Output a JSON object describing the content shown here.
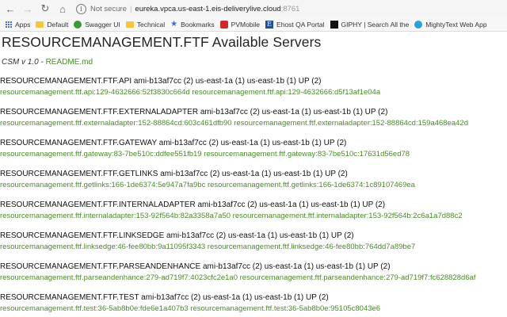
{
  "browser": {
    "security_label": "Not secure",
    "url_host": "eureka.vpca.us-east-1.eis-deliverylive.cloud",
    "url_port": ":8761",
    "bookmarks": [
      {
        "label": "Apps",
        "icon": "apps-grid-icon"
      },
      {
        "label": "Default",
        "icon": "folder-icon"
      },
      {
        "label": "Swagger UI",
        "icon": "swagger-icon"
      },
      {
        "label": "Technical",
        "icon": "folder-icon"
      },
      {
        "label": "Bookmarks",
        "icon": "star-icon"
      },
      {
        "label": "PVMobile",
        "icon": "pvmobile-icon"
      },
      {
        "label": "Ehost QA Portal",
        "icon": "ehost-icon"
      },
      {
        "label": "GIPHY | Search All the",
        "icon": "giphy-icon"
      },
      {
        "label": "MightyText Web App",
        "icon": "mightytext-icon"
      }
    ]
  },
  "page": {
    "title": "RESOURCEMANAGEMENT.FTF Available Servers",
    "version": "CSM v 1.0 - ",
    "readme_link": "README.md"
  },
  "servers": [
    {
      "name": "RESOURCEMANAGEMENT.FTF.API",
      "details": "ami-b13af7cc (2) us-east-1a (1) us-east-1b (1) UP (2)",
      "links": "resourcemanagement.ftf.api:129-4632666:52f3830c664d resourcemanagement.ftf.api:129-4632666:d5f13af1e04a"
    },
    {
      "name": "RESOURCEMANAGEMENT.FTF.EXTERNALADAPTER",
      "details": "ami-b13af7cc (2) us-east-1a (1) us-east-1b (1) UP (2)",
      "links": "resourcemanagement.ftf.externaladapter:152-88864cd:603c461dfb90 resourcemanagement.ftf.externaladapter:152-88864cd:159a468ea42d"
    },
    {
      "name": "RESOURCEMANAGEMENT.FTF.GATEWAY",
      "details": "ami-b13af7cc (2) us-east-1a (1) us-east-1b (1) UP (2)",
      "links": "resourcemanagement.ftf.gateway:83-7be510c:ddfee551fb19 resourcemanagement.ftf.gateway:83-7be510c:17631d56ed78"
    },
    {
      "name": "RESOURCEMANAGEMENT.FTF.GETLINKS",
      "details": "ami-b13af7cc (2) us-east-1a (1) us-east-1b (1) UP (2)",
      "links": "resourcemanagement.ftf.getlinks:166-1de6374:5e947a7fa9bc resourcemanagement.ftf.getlinks:166-1de6374:1c89107469ea"
    },
    {
      "name": "RESOURCEMANAGEMENT.FTF.INTERNALADAPTER",
      "details": "ami-b13af7cc (2) us-east-1a (1) us-east-1b (1) UP (2)",
      "links": "resourcemanagement.ftf.internaladapter:153-92f564b:82a3358a7a50 resourcemanagement.ftf.internaladapter:153-92f564b:2c6a1a7d88c2"
    },
    {
      "name": "RESOURCEMANAGEMENT.FTF.LINKSEDGE",
      "details": "ami-b13af7cc (2) us-east-1a (1) us-east-1b (1) UP (2)",
      "links": "resourcemanagement.ftf.linksedge:46-fee80bb:9a11095f3343 resourcemanagement.ftf.linksedge:46-fee80bb:764dd7a89be7"
    },
    {
      "name": "RESOURCEMANAGEMENT.FTF.PARSEANDENHANCE",
      "details": "ami-b13af7cc (2) us-east-1a (1) us-east-1b (1) UP (2)",
      "links": "resourcemanagement.ftf.parseandenhance:279-ad719f7:4023cfc2e1a0 resourcemanagement.ftf.parseandenhance:279-ad719f7:fc628828d6af"
    },
    {
      "name": "RESOURCEMANAGEMENT.FTF.TEST",
      "details": "ami-b13af7cc (2) us-east-1a (1) us-east-1b (1) UP (2)",
      "links": "resourcemanagement.ftf.test:36-5ab8b0e:fde6e1a407b3 resourcemanagement.ftf.test:36-5ab8b0e:95105c8043e6"
    }
  ]
}
